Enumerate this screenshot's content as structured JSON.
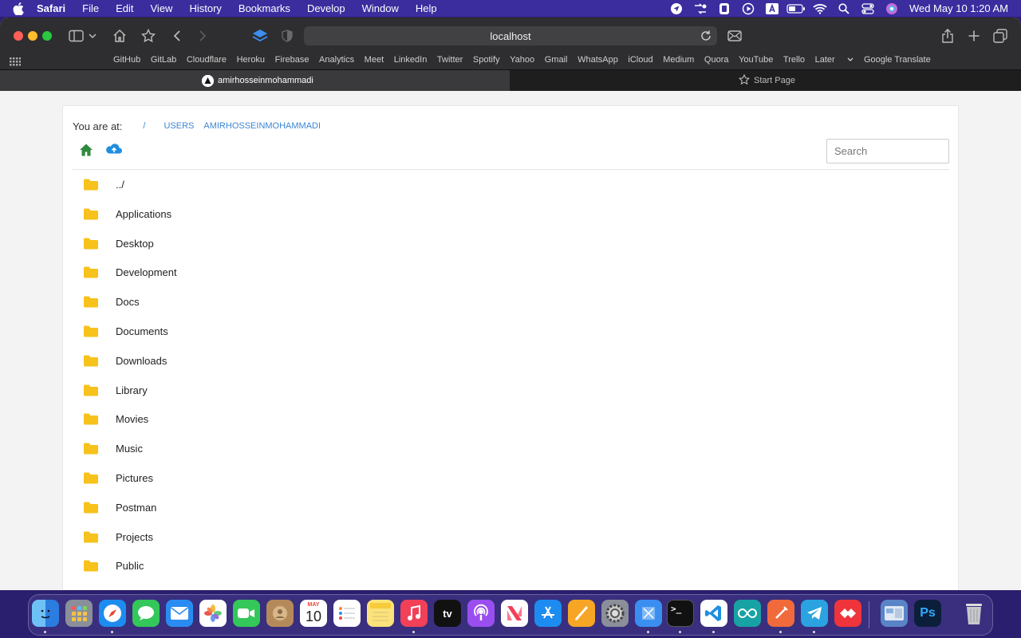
{
  "menubar": {
    "app": "Safari",
    "items": [
      "File",
      "Edit",
      "View",
      "History",
      "Bookmarks",
      "Develop",
      "Window",
      "Help"
    ],
    "clock": "Wed May 10  1:20 AM"
  },
  "browser": {
    "url": "localhost",
    "favorites": [
      "GitHub",
      "GitLab",
      "Cloudflare",
      "Heroku",
      "Firebase",
      "Analytics",
      "Meet",
      "LinkedIn",
      "Twitter",
      "Spotify",
      "Yahoo",
      "Gmail",
      "WhatsApp",
      "iCloud",
      "Medium",
      "Quora",
      "YouTube",
      "Trello",
      "Later",
      "Google Translate"
    ],
    "tabs": [
      {
        "label": "amirhosseinmohammadi",
        "active": true
      },
      {
        "label": "Start Page",
        "active": false
      }
    ]
  },
  "page": {
    "location_label": "You are at:",
    "breadcrumb": [
      "/",
      "USERS",
      "AMIRHOSSEINMOHAMMADI"
    ],
    "search_placeholder": "Search",
    "entries": [
      "../",
      "Applications",
      "Desktop",
      "Development",
      "Docs",
      "Documents",
      "Downloads",
      "Library",
      "Movies",
      "Music",
      "Pictures",
      "Postman",
      "Projects",
      "Public"
    ]
  },
  "dock": {
    "calendar_month": "MAY",
    "calendar_day": "10",
    "tv_label": "tv",
    "ps_label": "Ps"
  },
  "colors": {
    "menubar": "#3b2d9e",
    "folder": "#f7c21b",
    "link": "#3b86d4",
    "home_icon": "#2f8a3c",
    "upload_icon": "#1f8fe0"
  }
}
